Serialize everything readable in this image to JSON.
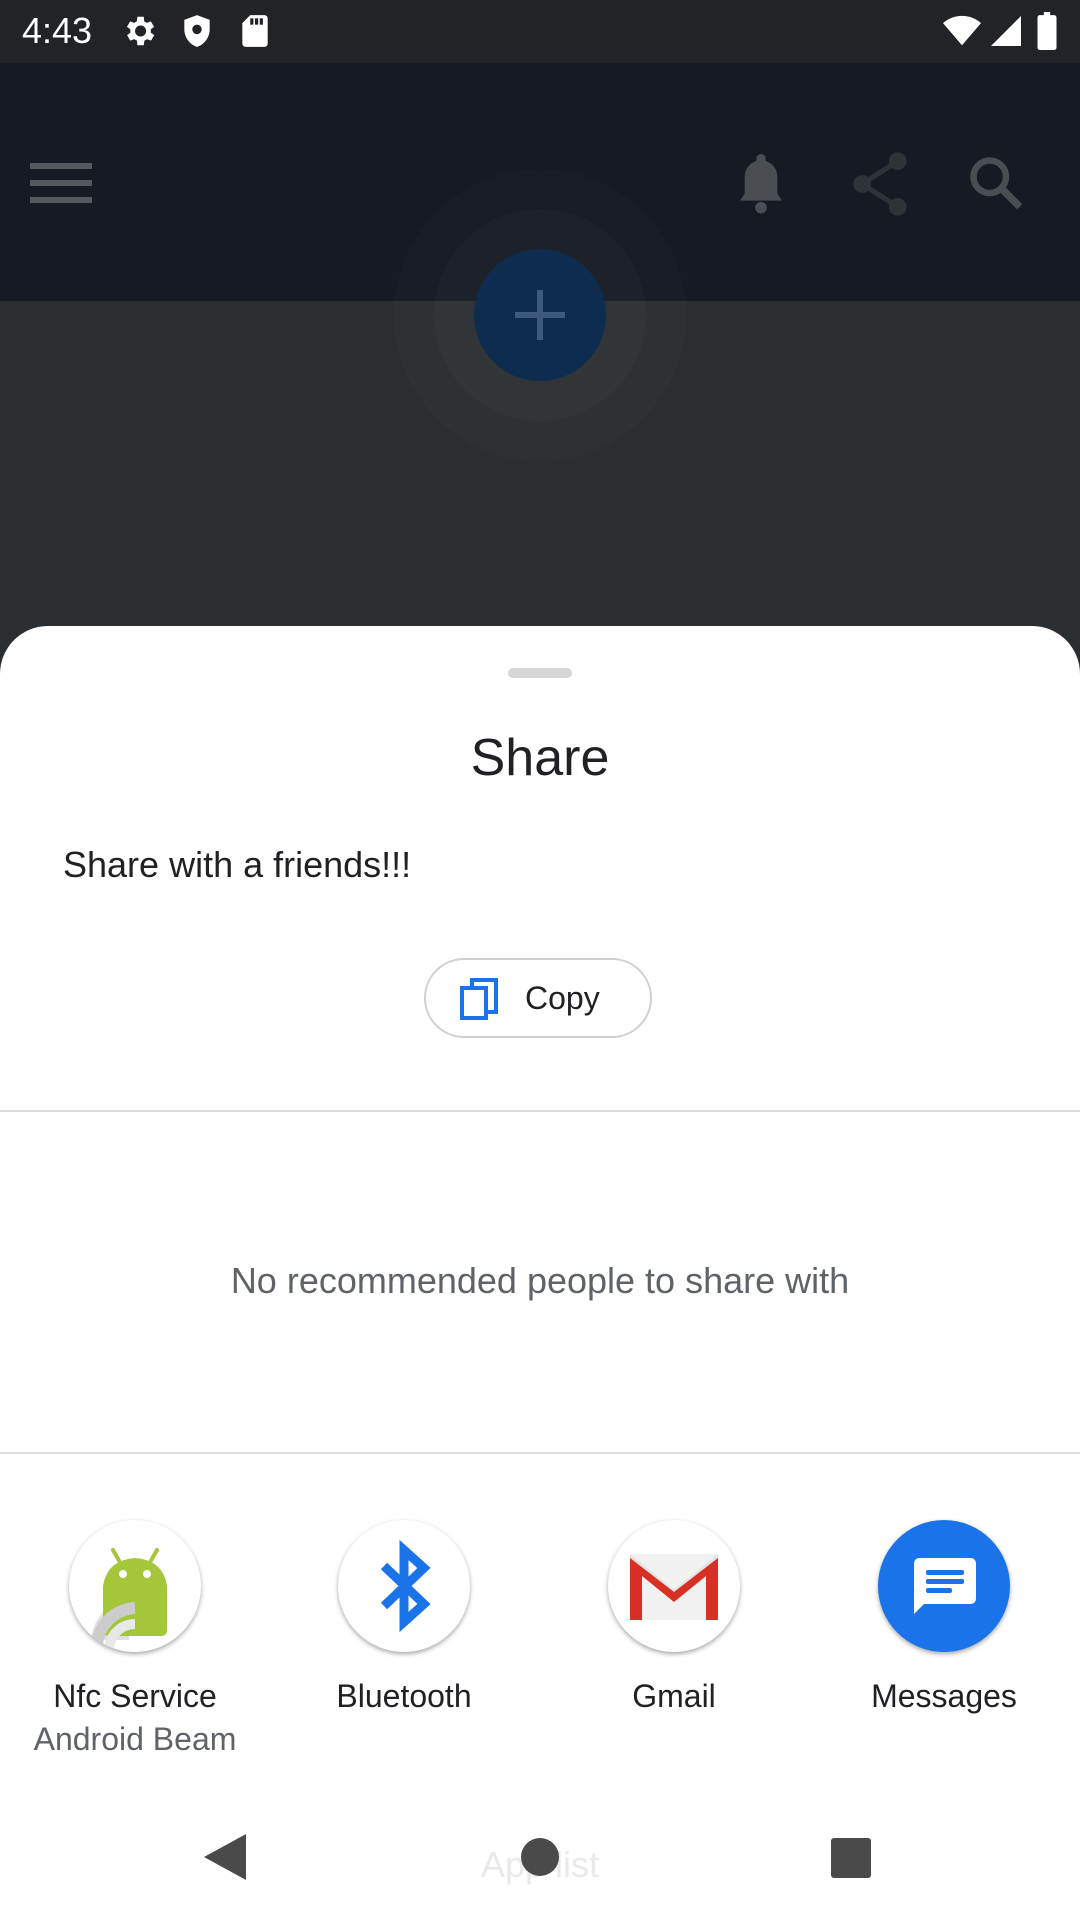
{
  "status": {
    "time": "4:43"
  },
  "background_app": {
    "icons": [
      "menu-icon",
      "bell-icon",
      "share-icon",
      "search-icon"
    ],
    "fab_icon": "plus-icon",
    "ghost_text": "App list"
  },
  "sheet": {
    "title": "Share",
    "share_text": "Share with a friends!!!",
    "copy_label": "Copy",
    "no_people_text": "No recommended people to share with",
    "targets": [
      {
        "label": "Nfc Service",
        "sublabel": "Android Beam",
        "icon": "android-icon"
      },
      {
        "label": "Bluetooth",
        "sublabel": "",
        "icon": "bluetooth-icon"
      },
      {
        "label": "Gmail",
        "sublabel": "",
        "icon": "gmail-icon"
      },
      {
        "label": "Messages",
        "sublabel": "",
        "icon": "messages-icon"
      }
    ]
  },
  "colors": {
    "accent_blue": "#1a73e8",
    "android_green": "#a4c639",
    "gmail_red": "#d93025"
  }
}
